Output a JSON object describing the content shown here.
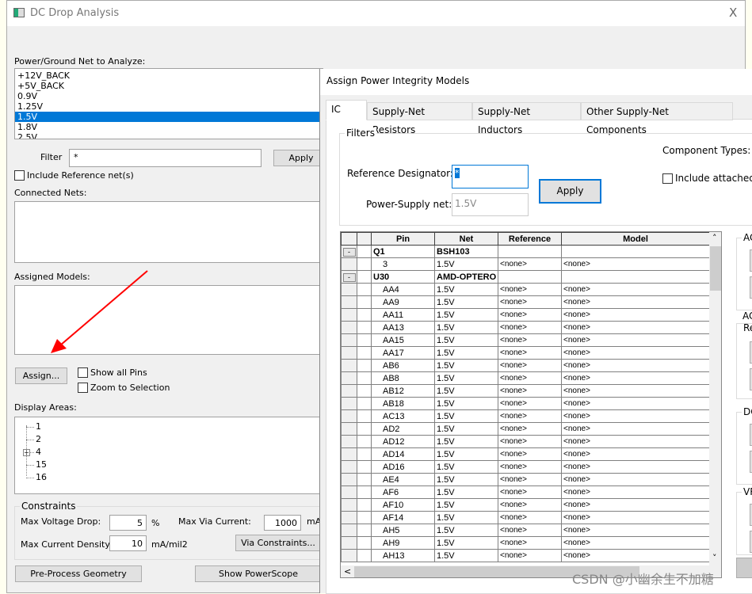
{
  "main": {
    "title": "DC Drop Analysis",
    "close": "X",
    "net_label": "Power/Ground Net to Analyze:",
    "nets": [
      "+12V_BACK",
      "+5V_BACK",
      "0.9V",
      "1.25V",
      "1.5V",
      "1.8V",
      "2.5V"
    ],
    "selected_net": "1.5V",
    "filter_label": "Filter",
    "filter_value": "*",
    "apply": "Apply",
    "include_ref": "Include Reference net(s)",
    "connected_nets": "Connected Nets:",
    "assigned_models": "Assigned Models:",
    "assign": "Assign...",
    "show_all_pins": "Show all Pins",
    "zoom_selection": "Zoom to Selection",
    "display_areas": "Display Areas:",
    "areas": [
      "1",
      "2",
      "4",
      "15",
      "16"
    ],
    "constraints": {
      "title": "Constraints",
      "max_vdrop": "Max Voltage Drop:",
      "max_vdrop_val": "5",
      "pct": "%",
      "max_via": "Max Via Current:",
      "max_via_val": "1000",
      "ma": "mA",
      "max_density": "Max Current Density:",
      "max_density_val": "10",
      "density_unit": "mA/mil2",
      "via_constraints": "Via Constraints..."
    },
    "preprocess": "Pre-Process Geometry",
    "powerscope": "Show PowerScope"
  },
  "dialog": {
    "title": "Assign Power Integrity Models",
    "tabs": [
      "IC",
      "Supply-Net Resistors",
      "Supply-Net Inductors",
      "Other Supply-Net Components"
    ],
    "active_tab": "IC",
    "filters": "Filters",
    "ref_des_label": "Reference Designator:",
    "ref_des_value": "*",
    "apply": "Apply",
    "ps_net_label": "Power-Supply net:",
    "ps_net_value": "1.5V",
    "component_types": "Component Types:",
    "include_attached": "Include attached",
    "columns": [
      "Pin",
      "Net",
      "Reference",
      "Model"
    ],
    "groups": [
      {
        "comp": "Q1",
        "part": "BSH103",
        "pins": [
          "3"
        ]
      },
      {
        "comp": "U30",
        "part": "AMD-OPTERO",
        "pins": [
          "AA4",
          "AA9",
          "AA11",
          "AA13",
          "AA15",
          "AA17",
          "AB6",
          "AB8",
          "AB12",
          "AB18",
          "AC13",
          "AD2",
          "AD12",
          "AD14",
          "AD16",
          "AE4",
          "AF6",
          "AF10",
          "AF14",
          "AH5",
          "AH9",
          "AH13"
        ]
      }
    ],
    "net": "1.5V",
    "none": "<none>",
    "collapse": "-",
    "side_groups": [
      "AC",
      "AC",
      "Re",
      "DC",
      "VR"
    ]
  },
  "watermark": "CSDN @小幽余生不加糖",
  "colors": {
    "selection": "#0078d7",
    "arrow": "#ff0000"
  }
}
